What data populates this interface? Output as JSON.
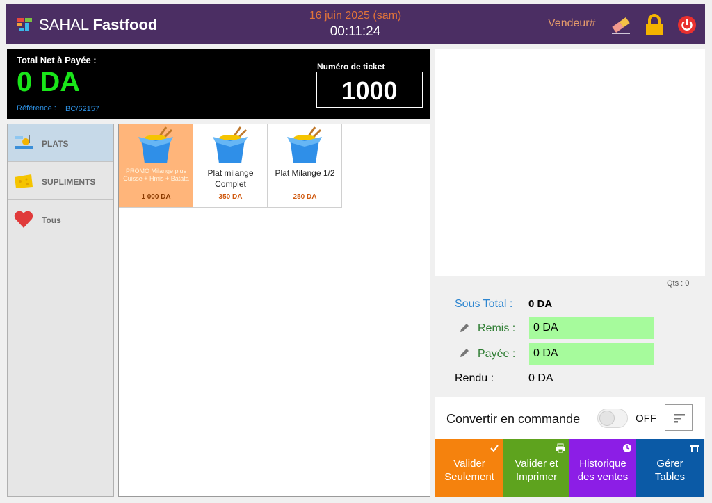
{
  "header": {
    "app_name_light": "SAHAL",
    "app_name_bold": "Fastfood",
    "date": "16 juin 2025 (sam)",
    "time": "00:11:24",
    "vendeur": "Vendeur#",
    "icons": [
      "eraser-icon",
      "lock-icon",
      "power-icon"
    ],
    "colors": {
      "background": "#4b2e63",
      "date": "#e0733a",
      "vendeur": "#e59b6b"
    }
  },
  "total": {
    "label": "Total Net à Payée :",
    "value": "0 DA",
    "reference_label": "Référence :",
    "reference_value": "BC/62157",
    "ticket_label": "Numéro de ticket",
    "ticket_number": "1000",
    "colors": {
      "value": "#19e619",
      "reference": "#2d8fe0"
    }
  },
  "categories": [
    {
      "label": "PLATS",
      "icon": "plate-icon",
      "active": true
    },
    {
      "label": "SUPLIMENTS",
      "icon": "cheese-icon",
      "active": false
    },
    {
      "label": "Tous",
      "icon": "heart-icon",
      "active": false
    }
  ],
  "products": [
    {
      "name": "PROMO Milange plus Cuisse + Hmis + Batata",
      "price": "1 000 DA",
      "icon": "noodle-box-icon",
      "highlight": true
    },
    {
      "name": "Plat milange Complet",
      "price": "350 DA",
      "icon": "noodle-box-icon",
      "highlight": false
    },
    {
      "name": "Plat Milange 1/2",
      "price": "250 DA",
      "icon": "noodle-box-icon",
      "highlight": false
    }
  ],
  "summary": {
    "qts": "Qts : 0",
    "sous_total_label": "Sous Total :",
    "sous_total_value": "0 DA",
    "remis_label": "Remis :",
    "remis_value": "0 DA",
    "payee_label": "Payée :",
    "payee_value": "0 DA",
    "rendu_label": "Rendu :",
    "rendu_value": "0 DA"
  },
  "convert": {
    "label": "Convertir en commande",
    "toggle_state": "OFF"
  },
  "actions": [
    {
      "line1": "Valider",
      "line2": "Seulement",
      "icon": "check-icon",
      "color": "#f5820d"
    },
    {
      "line1": "Valider et",
      "line2": "Imprimer",
      "icon": "printer-icon",
      "color": "#5ea31e"
    },
    {
      "line1": "Historique",
      "line2": "des ventes",
      "icon": "history-icon",
      "color": "#8c1ee6"
    },
    {
      "line1": "Gérer",
      "line2": "Tables",
      "icon": "table-icon",
      "color": "#0b5aa6"
    }
  ]
}
